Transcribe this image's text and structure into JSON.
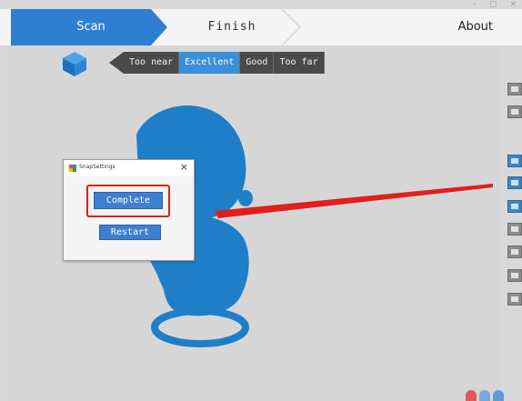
{
  "window_controls": [
    "–",
    "□",
    "×"
  ],
  "nav": {
    "scan": "Scan",
    "finish": "Finish",
    "about": "About"
  },
  "distance": {
    "options": [
      "Too near",
      "Excellent",
      "Good",
      "Too far"
    ],
    "selected": "Excellent"
  },
  "dialog": {
    "title": "SnapSettings",
    "close": "×",
    "complete": "Complete",
    "restart": "Restart"
  },
  "colors": {
    "accent": "#3a8fd6",
    "model": "#1e7fc8",
    "laser": "#e0201c",
    "highlight": "#e0201c"
  },
  "right_toolbar": [
    "image-icon",
    "image-icon",
    "play-icon",
    "square-icon",
    "undo-icon",
    "save-icon",
    "grid-icon",
    "texture-icon",
    "download-icon"
  ]
}
